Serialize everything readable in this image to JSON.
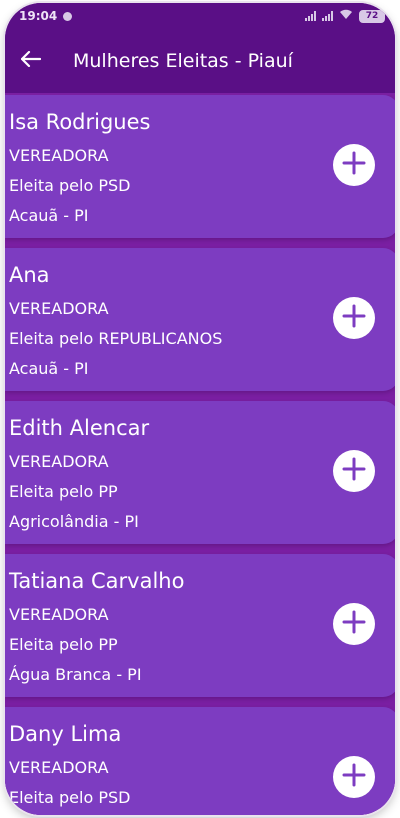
{
  "status_bar": {
    "time": "19:04",
    "battery": "72"
  },
  "app_bar": {
    "title": "Mulheres Eleitas - Piauí",
    "back_icon": "arrow-left-icon"
  },
  "colors": {
    "app_bar": "#5a0f86",
    "background": "#7a1fa2",
    "card": "#7d3cc1",
    "add_icon_fg": "#7d3cc1"
  },
  "list": {
    "items": [
      {
        "name": "Isa Rodrigues",
        "role": "VEREADORA",
        "party": "Eleita pelo PSD",
        "city": "Acauã - PI"
      },
      {
        "name": "Ana",
        "role": "VEREADORA",
        "party": "Eleita pelo REPUBLICANOS",
        "city": "Acauã - PI"
      },
      {
        "name": "Edith Alencar",
        "role": "VEREADORA",
        "party": "Eleita pelo PP",
        "city": "Agricolândia - PI"
      },
      {
        "name": "Tatiana Carvalho",
        "role": "VEREADORA",
        "party": "Eleita pelo PP",
        "city": "Água Branca - PI"
      },
      {
        "name": "Dany Lima",
        "role": "VEREADORA",
        "party": "Eleita pelo PSD",
        "city": ""
      }
    ],
    "add_icon": "plus-circle-icon"
  }
}
